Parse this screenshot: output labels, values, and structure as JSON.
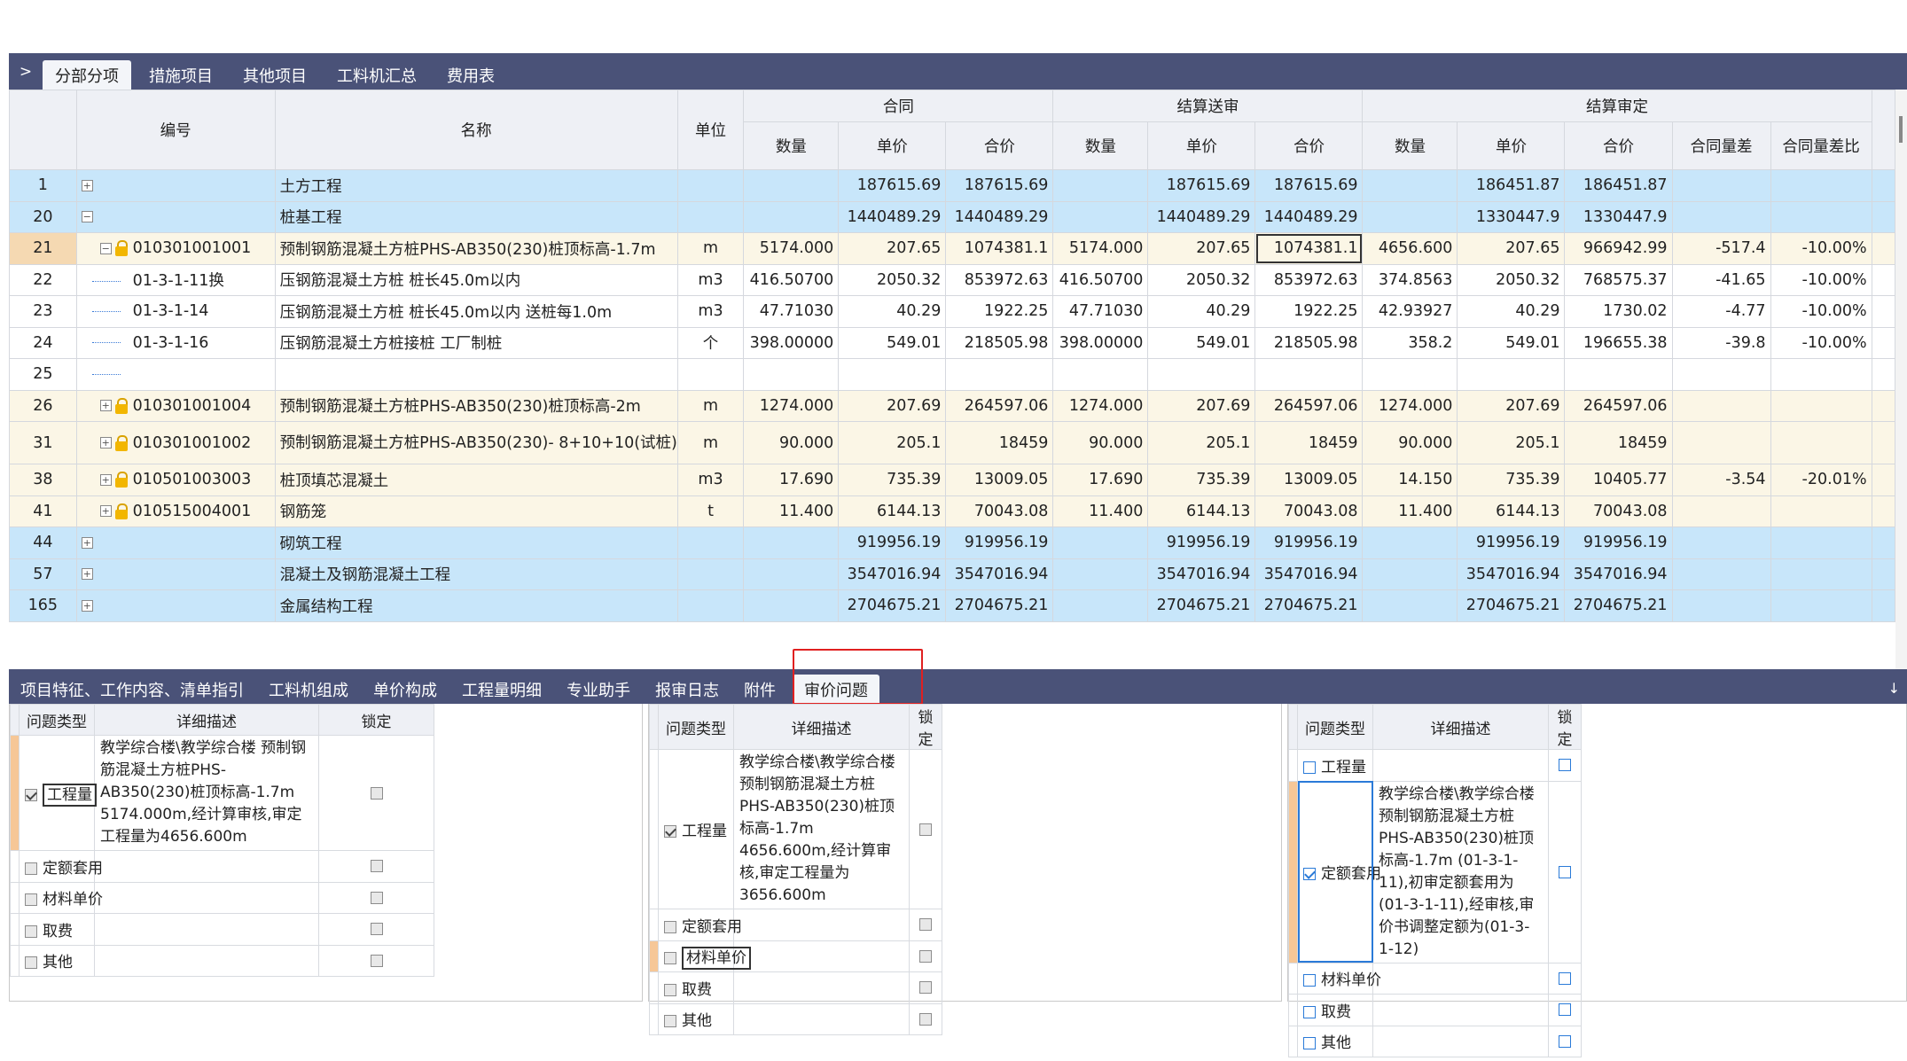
{
  "top_tabs": [
    "分部分项",
    "措施项目",
    "其他项目",
    "工料机汇总",
    "费用表"
  ],
  "top_tab_chevron": ">",
  "columns": {
    "code": "编号",
    "name": "名称",
    "unit": "单位",
    "group_contract": "合同",
    "group_submit": "结算送审",
    "group_approve": "结算审定",
    "qty": "数量",
    "unit_price": "单价",
    "total": "合价",
    "qty_diff": "合同量差",
    "qty_diff_ratio": "合同量差比"
  },
  "rows": [
    {
      "no": "1",
      "kind": "section",
      "exp": "+",
      "code": "",
      "name": "土方工程",
      "unit": "",
      "c": [
        "",
        "187615.69",
        "187615.69"
      ],
      "s": [
        "",
        "187615.69",
        "187615.69"
      ],
      "a": [
        "",
        "186451.87",
        "186451.87"
      ],
      "d": "",
      "r": ""
    },
    {
      "no": "20",
      "kind": "section",
      "exp": "−",
      "code": "",
      "name": "桩基工程",
      "unit": "",
      "c": [
        "",
        "1440489.29",
        "1440489.29"
      ],
      "s": [
        "",
        "1440489.29",
        "1440489.29"
      ],
      "a": [
        "",
        "1330447.9",
        "1330447.9"
      ],
      "d": "",
      "r": ""
    },
    {
      "no": "21",
      "kind": "item",
      "sel": true,
      "exp": "−",
      "lock": true,
      "code": "010301001001",
      "name": "预制钢筋混凝土方桩PHS-AB350(230)桩顶标高-1.7m",
      "unit": "m",
      "c": [
        "5174.000",
        "207.65",
        "1074381.1"
      ],
      "s": [
        "5174.000",
        "207.65",
        "1074381.1"
      ],
      "a": [
        "4656.600",
        "207.65",
        "966942.99"
      ],
      "d": "-517.4",
      "r": "-10.00%"
    },
    {
      "no": "22",
      "kind": "sub",
      "code": "01-3-1-11换",
      "name": "压钢筋混凝土方桩 桩长45.0m以内",
      "unit": "m3",
      "c": [
        "416.50700",
        "2050.32",
        "853972.63"
      ],
      "s": [
        "416.50700",
        "2050.32",
        "853972.63"
      ],
      "a": [
        "374.8563",
        "2050.32",
        "768575.37"
      ],
      "d": "-41.65",
      "r": "-10.00%"
    },
    {
      "no": "23",
      "kind": "sub",
      "code": "01-3-1-14",
      "name": "压钢筋混凝土方桩 桩长45.0m以内 送桩每1.0m",
      "unit": "m3",
      "c": [
        "47.71030",
        "40.29",
        "1922.25"
      ],
      "s": [
        "47.71030",
        "40.29",
        "1922.25"
      ],
      "a": [
        "42.93927",
        "40.29",
        "1730.02"
      ],
      "d": "-4.77",
      "r": "-10.00%"
    },
    {
      "no": "24",
      "kind": "sub",
      "code": "01-3-1-16",
      "name": "压钢筋混凝土方桩接桩 工厂制桩",
      "unit": "个",
      "c": [
        "398.00000",
        "549.01",
        "218505.98"
      ],
      "s": [
        "398.00000",
        "549.01",
        "218505.98"
      ],
      "a": [
        "358.2",
        "549.01",
        "196655.38"
      ],
      "d": "-39.8",
      "r": "-10.00%"
    },
    {
      "no": "25",
      "kind": "sub",
      "code": "",
      "name": "",
      "unit": "",
      "c": [
        "",
        "",
        ""
      ],
      "s": [
        "",
        "",
        ""
      ],
      "a": [
        "",
        "",
        ""
      ],
      "d": "",
      "r": ""
    },
    {
      "no": "26",
      "kind": "item",
      "exp": "+",
      "lock": true,
      "code": "010301001004",
      "name": "预制钢筋混凝土方桩PHS-AB350(230)桩顶标高-2m",
      "unit": "m",
      "c": [
        "1274.000",
        "207.69",
        "264597.06"
      ],
      "s": [
        "1274.000",
        "207.69",
        "264597.06"
      ],
      "a": [
        "1274.000",
        "207.69",
        "264597.06"
      ],
      "d": "",
      "r": ""
    },
    {
      "no": "31",
      "kind": "item",
      "tall": true,
      "exp": "+",
      "lock": true,
      "code": "010301001002",
      "name": "预制钢筋混凝土方桩PHS-AB350(230)- 8+10+10(试桩)",
      "unit": "m",
      "c": [
        "90.000",
        "205.1",
        "18459"
      ],
      "s": [
        "90.000",
        "205.1",
        "18459"
      ],
      "a": [
        "90.000",
        "205.1",
        "18459"
      ],
      "d": "",
      "r": ""
    },
    {
      "no": "38",
      "kind": "item",
      "exp": "+",
      "lock": true,
      "code": "010501003003",
      "name": "桩顶填芯混凝土",
      "unit": "m3",
      "c": [
        "17.690",
        "735.39",
        "13009.05"
      ],
      "s": [
        "17.690",
        "735.39",
        "13009.05"
      ],
      "a": [
        "14.150",
        "735.39",
        "10405.77"
      ],
      "d": "-3.54",
      "r": "-20.01%"
    },
    {
      "no": "41",
      "kind": "item",
      "exp": "+",
      "lock": true,
      "code": "010515004001",
      "name": "钢筋笼",
      "unit": "t",
      "c": [
        "11.400",
        "6144.13",
        "70043.08"
      ],
      "s": [
        "11.400",
        "6144.13",
        "70043.08"
      ],
      "a": [
        "11.400",
        "6144.13",
        "70043.08"
      ],
      "d": "",
      "r": ""
    },
    {
      "no": "44",
      "kind": "section",
      "exp": "+",
      "code": "",
      "name": "砌筑工程",
      "unit": "",
      "c": [
        "",
        "919956.19",
        "919956.19"
      ],
      "s": [
        "",
        "919956.19",
        "919956.19"
      ],
      "a": [
        "",
        "919956.19",
        "919956.19"
      ],
      "d": "",
      "r": ""
    },
    {
      "no": "57",
      "kind": "section",
      "exp": "+",
      "code": "",
      "name": "混凝土及钢筋混凝土工程",
      "unit": "",
      "c": [
        "",
        "3547016.94",
        "3547016.94"
      ],
      "s": [
        "",
        "3547016.94",
        "3547016.94"
      ],
      "a": [
        "",
        "3547016.94",
        "3547016.94"
      ],
      "d": "",
      "r": ""
    },
    {
      "no": "165",
      "kind": "section",
      "exp": "+",
      "code": "",
      "name": "金属结构工程",
      "unit": "",
      "c": [
        "",
        "2704675.21",
        "2704675.21"
      ],
      "s": [
        "",
        "2704675.21",
        "2704675.21"
      ],
      "a": [
        "",
        "2704675.21",
        "2704675.21"
      ],
      "d": "",
      "r": ""
    }
  ],
  "bottom_tabs": [
    "项目特征、工作内容、清单指引",
    "工料机组成",
    "单价构成",
    "工程量明细",
    "专业助手",
    "报审日志",
    "附件",
    "审价问题"
  ],
  "bottom_arrow": "↓",
  "issue_headers": {
    "type": "问题类型",
    "desc": "详细描述",
    "lock": "锁定"
  },
  "panels": [
    {
      "rows": [
        {
          "type": "工程量",
          "checked": true,
          "desc": "教学综合楼\\教学综合楼 预制钢筋混凝土方桩PHS-AB350(230)桩顶标高-1.7m 5174.000m,经计算审核,审定工程量为4656.600m"
        },
        {
          "type": "定额套用",
          "checked": false,
          "desc": ""
        },
        {
          "type": "材料单价",
          "checked": false,
          "desc": ""
        },
        {
          "type": "取费",
          "checked": false,
          "desc": ""
        },
        {
          "type": "其他",
          "checked": false,
          "desc": ""
        }
      ]
    },
    {
      "rows": [
        {
          "type": "工程量",
          "checked": true,
          "desc": "教学综合楼\\教学综合楼 预制钢筋混凝土方桩PHS-AB350(230)桩顶标高-1.7m 4656.600m,经计算审核,审定工程量为3656.600m"
        },
        {
          "type": "定额套用",
          "checked": false,
          "desc": ""
        },
        {
          "type": "材料单价",
          "checked": false,
          "desc": ""
        },
        {
          "type": "取费",
          "checked": false,
          "desc": ""
        },
        {
          "type": "其他",
          "checked": false,
          "desc": ""
        }
      ]
    },
    {
      "rows": [
        {
          "type": "工程量",
          "checked": false,
          "desc": ""
        },
        {
          "type": "定额套用",
          "checked": true,
          "desc": "教学综合楼\\教学综合楼 预制钢筋混凝土方桩PHS-AB350(230)桩顶标高-1.7m (01-3-1-11),初审定额套用为(01-3-1-11),经审核,审价书调整定额为(01-3-1-12)"
        },
        {
          "type": "材料单价",
          "checked": false,
          "desc": ""
        },
        {
          "type": "取费",
          "checked": false,
          "desc": ""
        },
        {
          "type": "其他",
          "checked": false,
          "desc": ""
        }
      ]
    }
  ]
}
